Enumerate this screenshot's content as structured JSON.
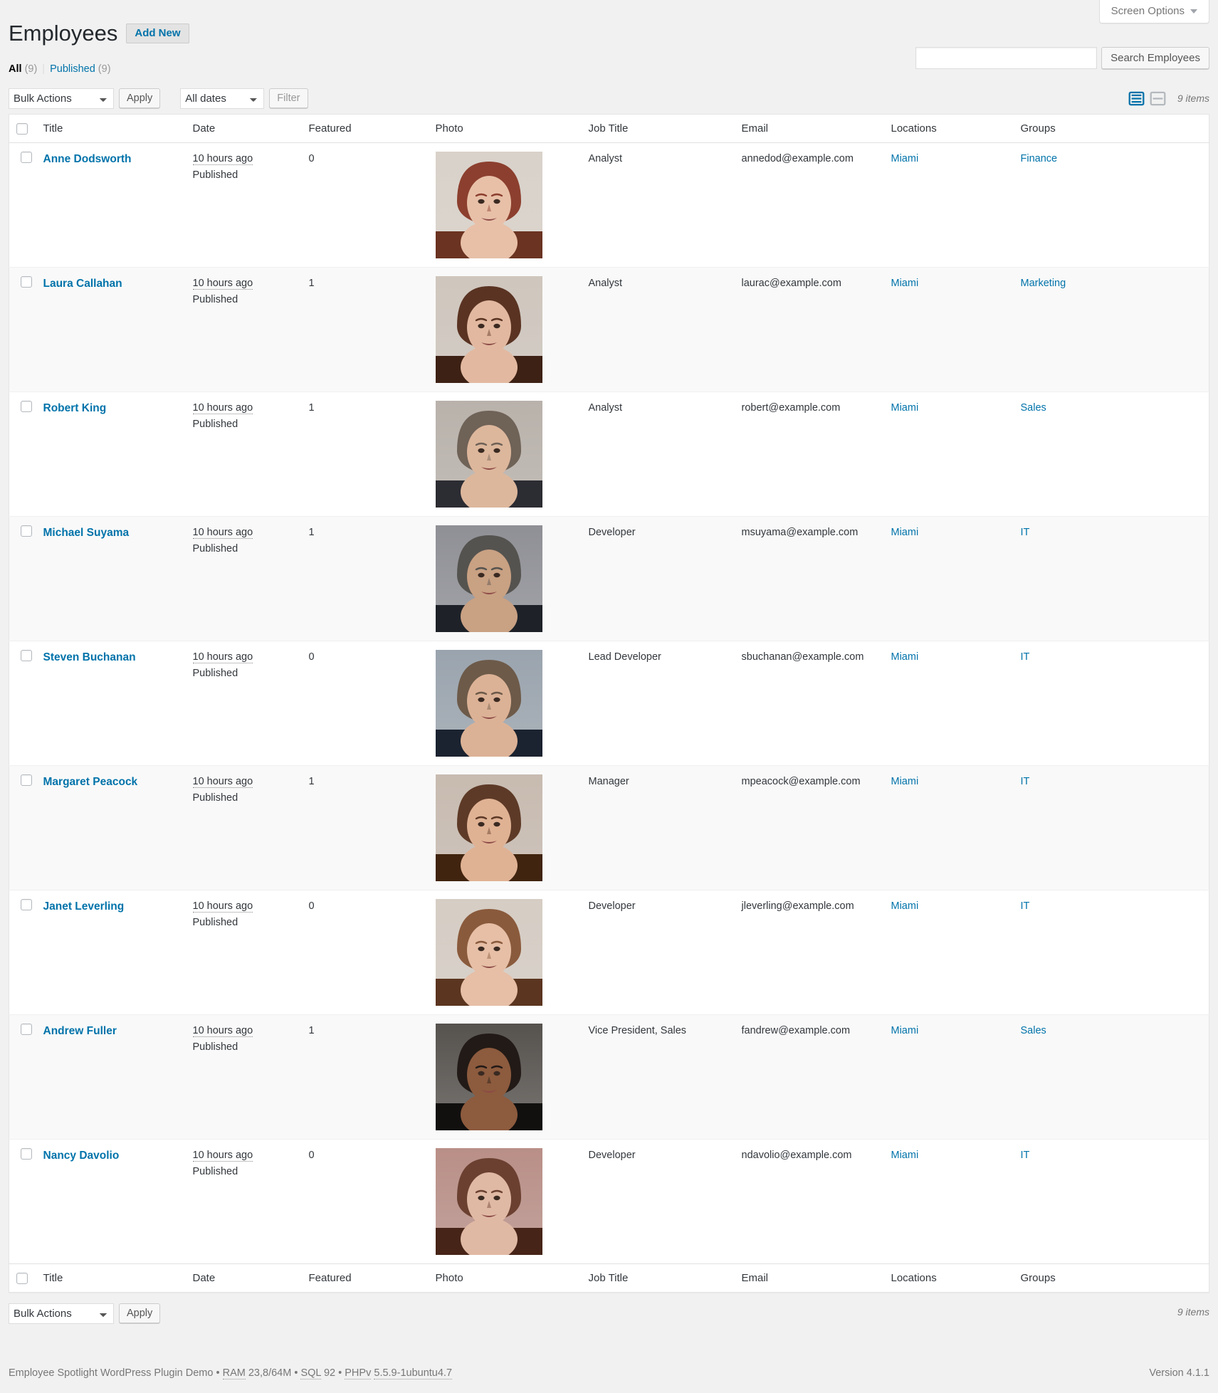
{
  "screen_options": {
    "label": "Screen Options",
    "caret_icon": "chevron-down-icon"
  },
  "header": {
    "title": "Employees",
    "add_new_label": "Add New"
  },
  "views": {
    "all": {
      "label": "All",
      "count": "(9)"
    },
    "published": {
      "label": "Published",
      "count": "(9)"
    },
    "separator": "|"
  },
  "search": {
    "value": "",
    "placeholder": "",
    "button_label": "Search Employees"
  },
  "tablenav_top": {
    "bulk_actions_selected": "Bulk Actions",
    "apply_label": "Apply",
    "dates_selected": "All dates",
    "filter_label": "Filter",
    "list_view_icon": "list-view-icon",
    "excerpt_view_icon": "excerpt-view-icon",
    "displaying_num": "9 items"
  },
  "tablenav_bottom": {
    "bulk_actions_selected": "Bulk Actions",
    "apply_label": "Apply",
    "displaying_num": "9 items"
  },
  "table": {
    "columns": [
      "Title",
      "Date",
      "Featured",
      "Photo",
      "Job Title",
      "Email",
      "Locations",
      "Groups"
    ],
    "rows": [
      {
        "title": "Anne Dodsworth",
        "date": "10 hours ago",
        "status": "Published",
        "featured": "0",
        "photo": "photo-anne-dodsworth",
        "job_title": "Analyst",
        "email": "annedod@example.com",
        "location": "Miami",
        "group": "Finance"
      },
      {
        "title": "Laura Callahan",
        "date": "10 hours ago",
        "status": "Published",
        "featured": "1",
        "photo": "photo-laura-callahan",
        "job_title": "Analyst",
        "email": "laurac@example.com",
        "location": "Miami",
        "group": "Marketing"
      },
      {
        "title": "Robert King",
        "date": "10 hours ago",
        "status": "Published",
        "featured": "1",
        "photo": "photo-robert-king",
        "job_title": "Analyst",
        "email": "robert@example.com",
        "location": "Miami",
        "group": "Sales"
      },
      {
        "title": "Michael Suyama",
        "date": "10 hours ago",
        "status": "Published",
        "featured": "1",
        "photo": "photo-michael-suyama",
        "job_title": "Developer",
        "email": "msuyama@example.com",
        "location": "Miami",
        "group": "IT"
      },
      {
        "title": "Steven Buchanan",
        "date": "10 hours ago",
        "status": "Published",
        "featured": "0",
        "photo": "photo-steven-buchanan",
        "job_title": "Lead Developer",
        "email": "sbuchanan@example.com",
        "location": "Miami",
        "group": "IT"
      },
      {
        "title": "Margaret Peacock",
        "date": "10 hours ago",
        "status": "Published",
        "featured": "1",
        "photo": "photo-margaret-peacock",
        "job_title": "Manager",
        "email": "mpeacock@example.com",
        "location": "Miami",
        "group": "IT"
      },
      {
        "title": "Janet Leverling",
        "date": "10 hours ago",
        "status": "Published",
        "featured": "0",
        "photo": "photo-janet-leverling",
        "job_title": "Developer",
        "email": "jleverling@example.com",
        "location": "Miami",
        "group": "IT"
      },
      {
        "title": "Andrew Fuller",
        "date": "10 hours ago",
        "status": "Published",
        "featured": "1",
        "photo": "photo-andrew-fuller",
        "job_title": "Vice President, Sales",
        "email": "fandrew@example.com",
        "location": "Miami",
        "group": "Sales"
      },
      {
        "title": "Nancy Davolio",
        "date": "10 hours ago",
        "status": "Published",
        "featured": "0",
        "photo": "photo-nancy-davolio",
        "job_title": "Developer",
        "email": "ndavolio@example.com",
        "location": "Miami",
        "group": "IT"
      }
    ]
  },
  "footer": {
    "credit_prefix": "Employee Spotlight WordPress Plugin Demo",
    "bullet": "•",
    "ram": "RAM",
    "ram_value": "23,8/64M",
    "sql": "SQL",
    "sql_value": "92",
    "php": "PHPv",
    "php_value": "5.5.9-1ubuntu4.7",
    "version": "Version 4.1.1"
  },
  "colors": {
    "link": "#0073aa",
    "active_view_icon": "#0073aa",
    "inactive_view_icon": "#b4b9be",
    "page_bg": "#f1f1f1",
    "row_alt_bg": "#f9f9f9"
  }
}
